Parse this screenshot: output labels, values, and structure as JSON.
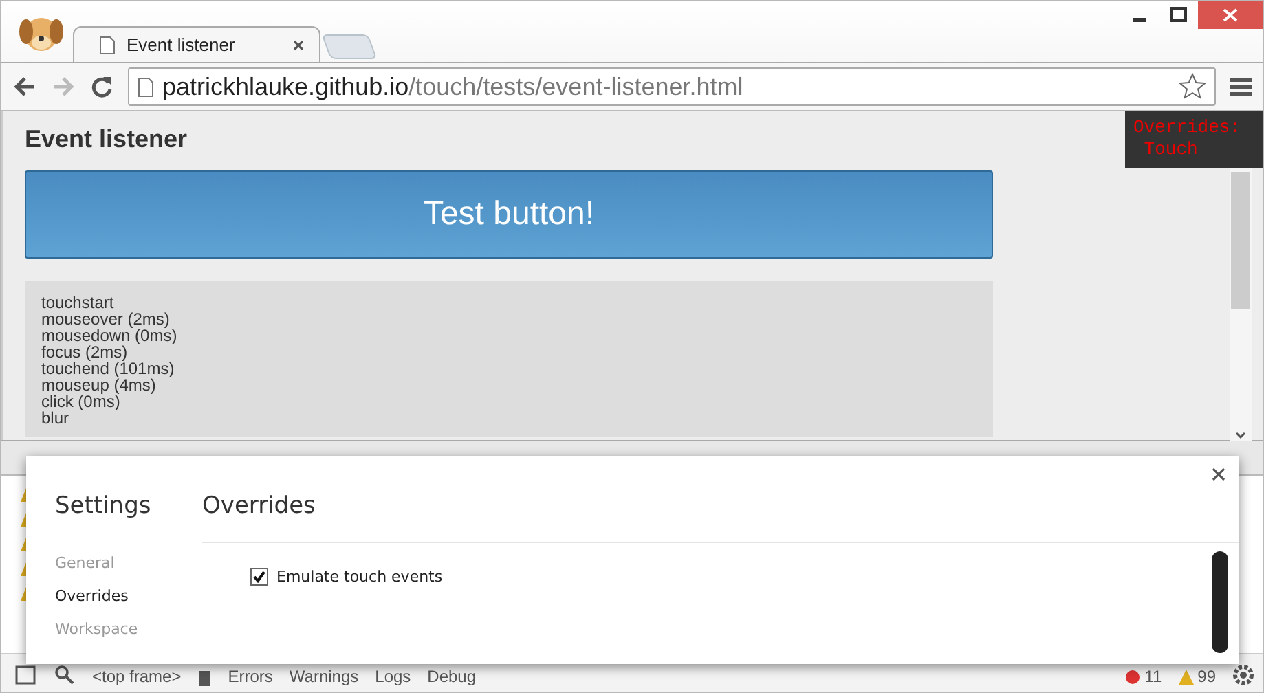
{
  "browser": {
    "tabs": [
      {
        "title": "Event listener",
        "selected": true
      }
    ],
    "address": {
      "host": "patrickhlauke.github.io",
      "path": "/touch/tests/event-listener.html"
    }
  },
  "page": {
    "heading": "Event listener",
    "button": "Test button!",
    "log": [
      "touchstart",
      "mouseover (2ms)",
      "mousedown (0ms)",
      "focus (2ms)",
      "touchend (101ms)",
      "mouseup (4ms)",
      "click (0ms)",
      "blur"
    ]
  },
  "overlay": {
    "lines": [
      "Overrides:",
      "Touch"
    ]
  },
  "devtools": {
    "frame": "<top frame>",
    "filters": [
      "Errors",
      "Warnings",
      "Logs",
      "Debug"
    ],
    "errors": "11",
    "warnings": "99"
  },
  "settings": {
    "title": "Settings",
    "heading": "Overrides",
    "sections": [
      {
        "label": "General",
        "selected": false
      },
      {
        "label": "Overrides",
        "selected": true
      },
      {
        "label": "Workspace",
        "selected": false
      }
    ],
    "options": [
      {
        "label": "Emulate touch events",
        "checked": true
      }
    ]
  }
}
